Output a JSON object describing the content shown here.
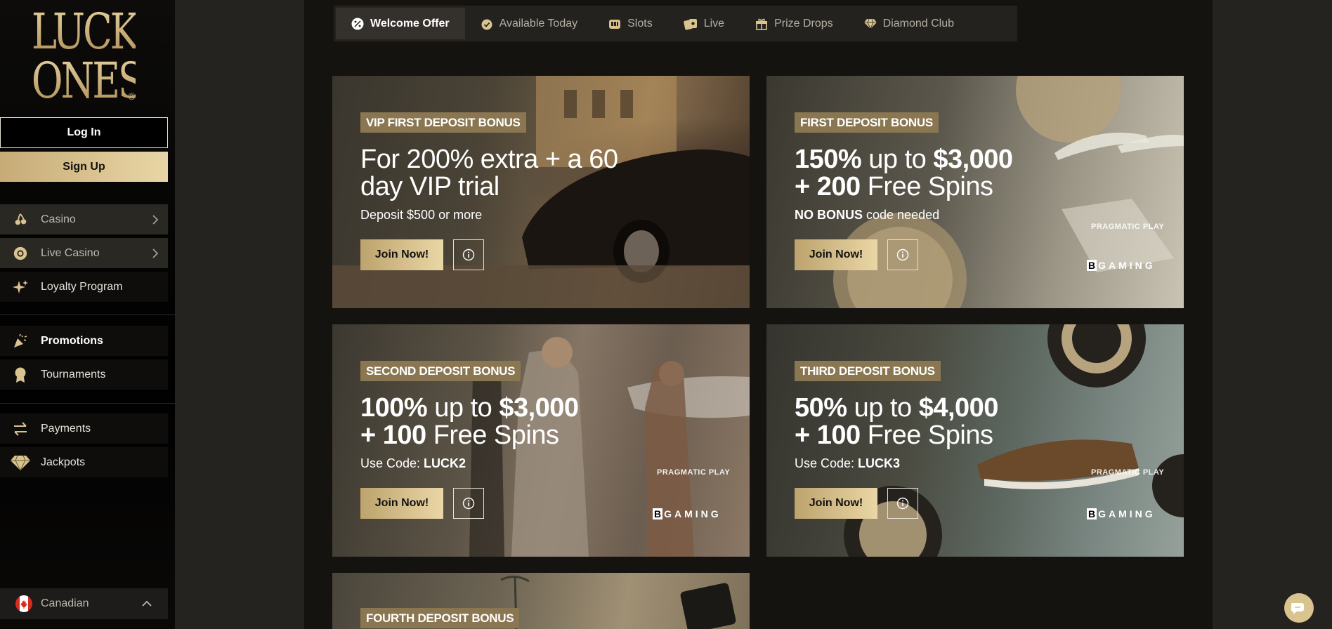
{
  "brand": {
    "logo_line1": "LUCKY",
    "logo_line2": "ONES",
    "logo_mark": "®"
  },
  "auth": {
    "login_label": "Log In",
    "signup_label": "Sign Up"
  },
  "sidebar": {
    "items": [
      {
        "label": "Casino",
        "icon": "cherries-icon",
        "has_chevron": true
      },
      {
        "label": "Live Casino",
        "icon": "chip-icon",
        "has_chevron": true
      },
      {
        "label": "Loyalty Program",
        "icon": "sparkle-icon",
        "has_chevron": false
      },
      {
        "label": "Promotions",
        "icon": "party-popper-icon",
        "active": true
      },
      {
        "label": "Tournaments",
        "icon": "award-icon"
      },
      {
        "label": "Payments",
        "icon": "transfer-arrows-icon"
      },
      {
        "label": "Jackpots",
        "icon": "diamond-icon"
      }
    ],
    "language": {
      "label": "Canadian",
      "icon": "canada-flag-icon"
    }
  },
  "tabs": [
    {
      "label": "Welcome Offer",
      "icon": "percent-badge-icon",
      "active": true
    },
    {
      "label": "Available Today",
      "icon": "clock-check-icon"
    },
    {
      "label": "Slots",
      "icon": "slot-machine-icon"
    },
    {
      "label": "Live",
      "icon": "live-cards-icon"
    },
    {
      "label": "Prize Drops",
      "icon": "gift-icon"
    },
    {
      "label": "Diamond Club",
      "icon": "diamond-icon"
    }
  ],
  "cards": [
    {
      "badge": "VIP FIRST DEPOSIT BONUS",
      "headline_line1": "For 200% extra + a 60",
      "headline_line2": "day VIP trial",
      "sub": "Deposit $500 or more",
      "join_label": "Join Now!"
    },
    {
      "badge": "FIRST DEPOSIT BONUS",
      "hl1_bold_a": "150%",
      "hl1_text": " up to ",
      "hl1_bold_b": "$3,000",
      "hl2_bold": "+ 200",
      "hl2_text": " Free Spins",
      "sub_bold": "NO BONUS",
      "sub_text": " code needed",
      "join_label": "Join Now!",
      "provider_a": "PRAGMATIC PLAY",
      "provider_b": "GAMING"
    },
    {
      "badge": "SECOND DEPOSIT BONUS",
      "hl1_bold_a": "100%",
      "hl1_text": " up to ",
      "hl1_bold_b": "$3,000",
      "hl2_bold": "+ 100",
      "hl2_text": " Free Spins",
      "sub_text": "Use Code: ",
      "sub_bold": "LUCK2",
      "join_label": "Join Now!",
      "provider_a": "PRAGMATIC PLAY",
      "provider_b": "GAMING"
    },
    {
      "badge": "THIRD DEPOSIT BONUS",
      "hl1_bold_a": "50%",
      "hl1_text": " up to ",
      "hl1_bold_b": "$4,000",
      "hl2_bold": "+ 100",
      "hl2_text": " Free Spins",
      "sub_text": "Use Code: ",
      "sub_bold": "LUCK3",
      "join_label": "Join Now!",
      "provider_a": "PRAGMATIC PLAY",
      "provider_b": "GAMING"
    },
    {
      "badge": "FOURTH DEPOSIT BONUS"
    }
  ],
  "colors": {
    "gold": "#c9ad7a",
    "badge": "#8a7752",
    "bg_main": "#141310"
  }
}
